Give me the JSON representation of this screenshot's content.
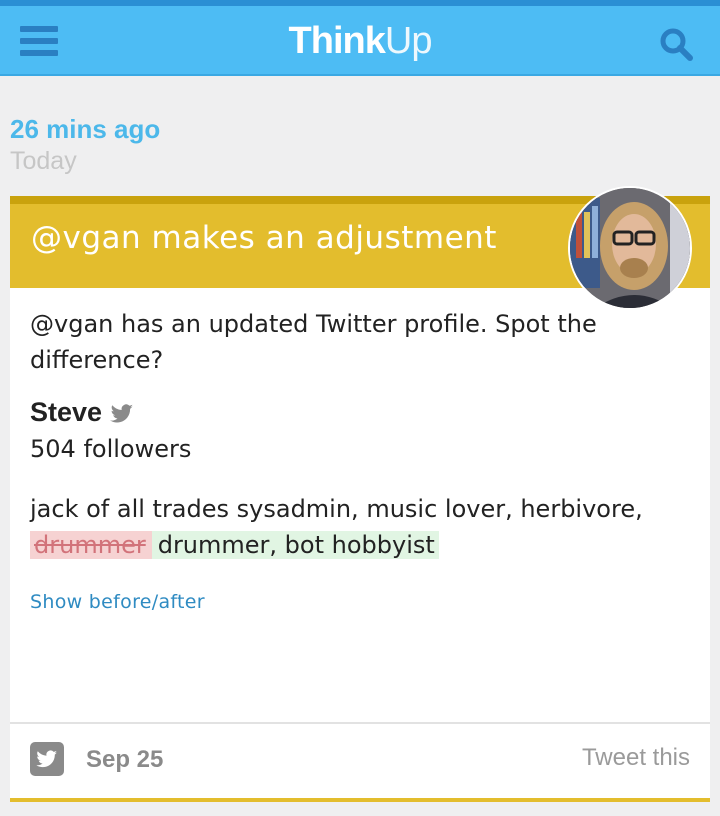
{
  "header": {
    "logo_bold": "Think",
    "logo_light": "Up"
  },
  "insight": {
    "time_ago": "26 mins ago",
    "date_label": "Today",
    "title": "@vgan makes an adjustment",
    "body": "@vgan has an updated Twitter profile. Spot the difference?",
    "profile": {
      "name": "Steve",
      "followers": "504 followers",
      "bio_prefix": "jack of all trades sysadmin, music lover, herbivore,",
      "bio_removed": "drummer",
      "bio_added": "drummer, bot hobbyist"
    },
    "show_link": "Show before/after",
    "footer": {
      "date": "Sep 25",
      "tweet_label": "Tweet this"
    }
  },
  "icons": [
    "menu-icon",
    "search-icon",
    "twitter-bird-icon",
    "twitter-icon"
  ],
  "colors": {
    "topbar": "#4dbcf4",
    "accent_blue": "#4cb8ea",
    "card_header": "#e3bd2d",
    "link": "#2f8bc2"
  }
}
